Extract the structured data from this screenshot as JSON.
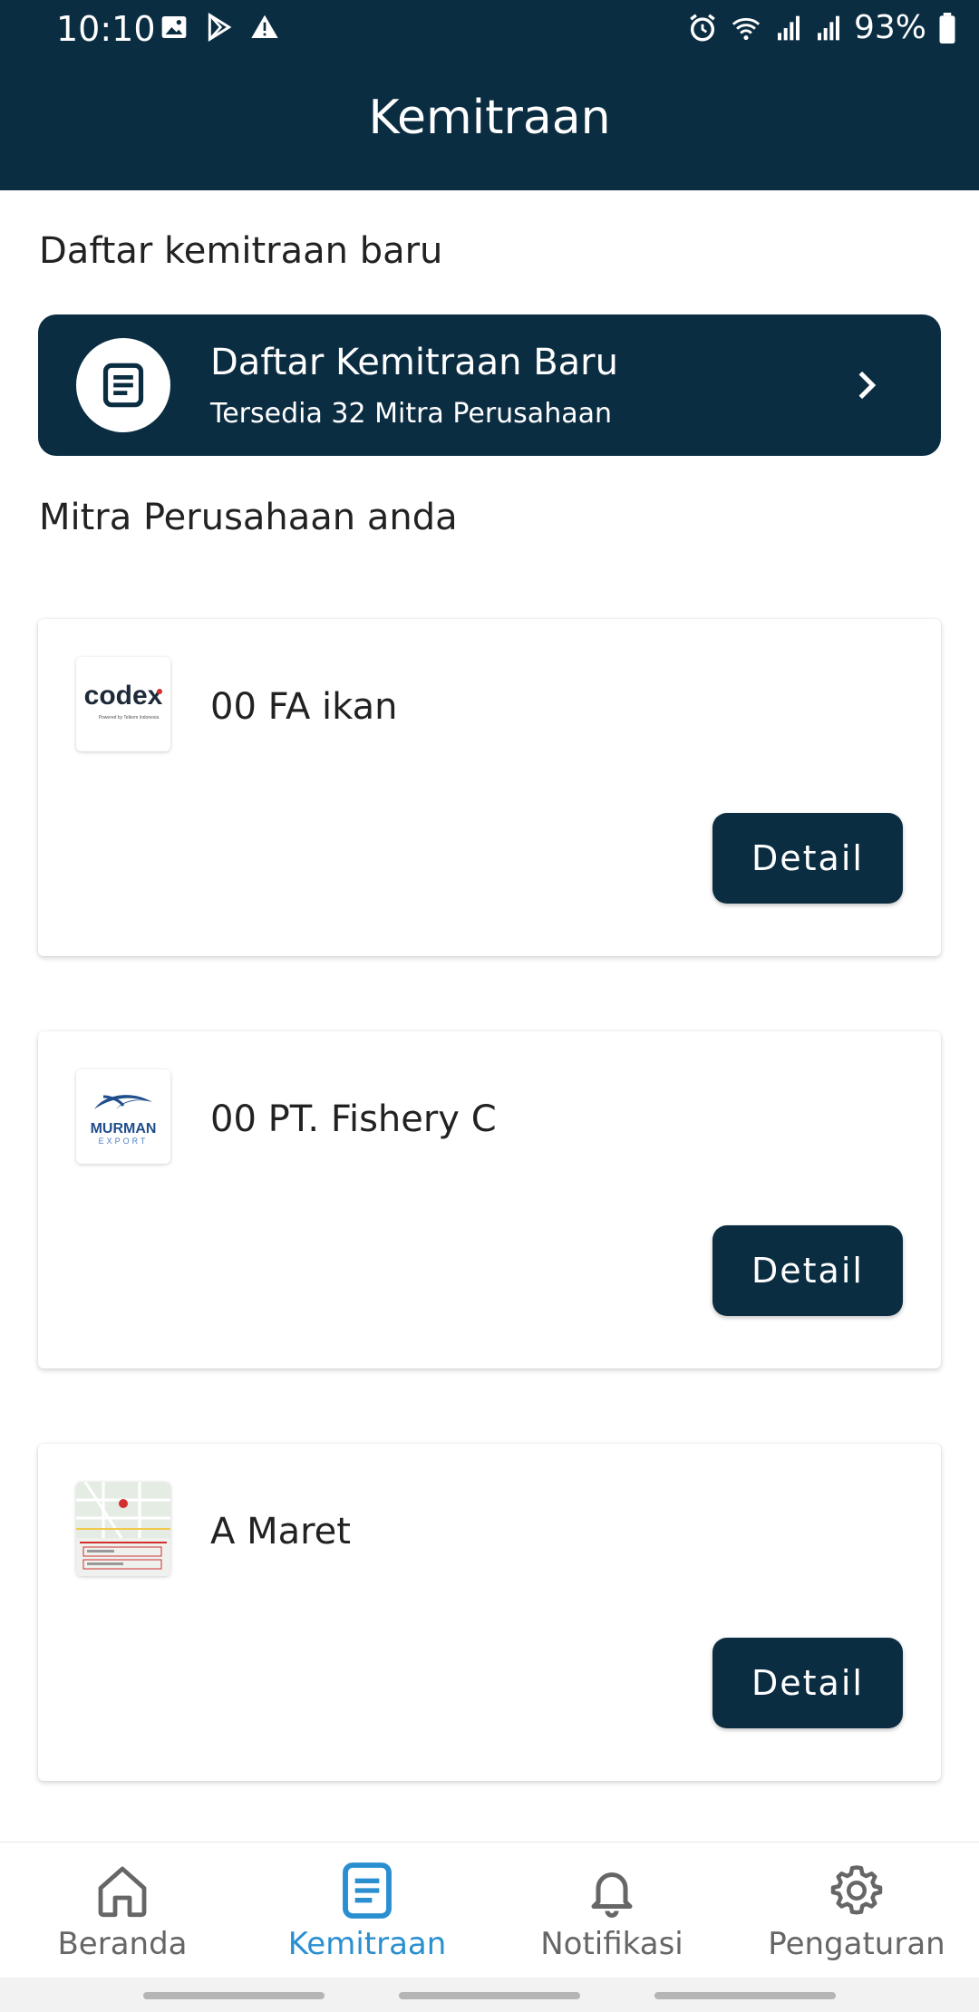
{
  "status_bar": {
    "time": "10:10",
    "battery_pct": "93%",
    "icons": [
      "image-icon",
      "play-store-icon",
      "warning-icon",
      "alarm-icon",
      "wifi-icon",
      "signal-icon",
      "signal-icon",
      "battery-icon"
    ]
  },
  "header": {
    "title": "Kemitraan"
  },
  "new_partnership": {
    "section_label": "Daftar kemitraan baru",
    "banner_title": "Daftar Kemitraan Baru",
    "banner_subtitle": "Tersedia 32 Mitra Perusahaan",
    "icon": "document-icon"
  },
  "partners": {
    "section_label": "Mitra Perusahaan anda",
    "items": [
      {
        "name": "00 FA ikan",
        "button": "Detail",
        "logo_text": "codex",
        "logo_subtext": "Powered by Telkom Indonesia"
      },
      {
        "name": "00 PT. Fishery C",
        "button": "Detail",
        "logo_text": "MURMAN",
        "logo_subtext": "EXPORT"
      },
      {
        "name": "A Maret",
        "button": "Detail"
      }
    ]
  },
  "bottom_nav": {
    "items": [
      {
        "label": "Beranda",
        "icon": "home-icon",
        "active": false
      },
      {
        "label": "Kemitraan",
        "icon": "document-icon",
        "active": true
      },
      {
        "label": "Notifikasi",
        "icon": "bell-icon",
        "active": false
      },
      {
        "label": "Pengaturan",
        "icon": "gear-icon",
        "active": false
      }
    ]
  },
  "colors": {
    "primary": "#0b2d42",
    "active_nav": "#2a8fd0",
    "inactive_nav": "#666666"
  }
}
